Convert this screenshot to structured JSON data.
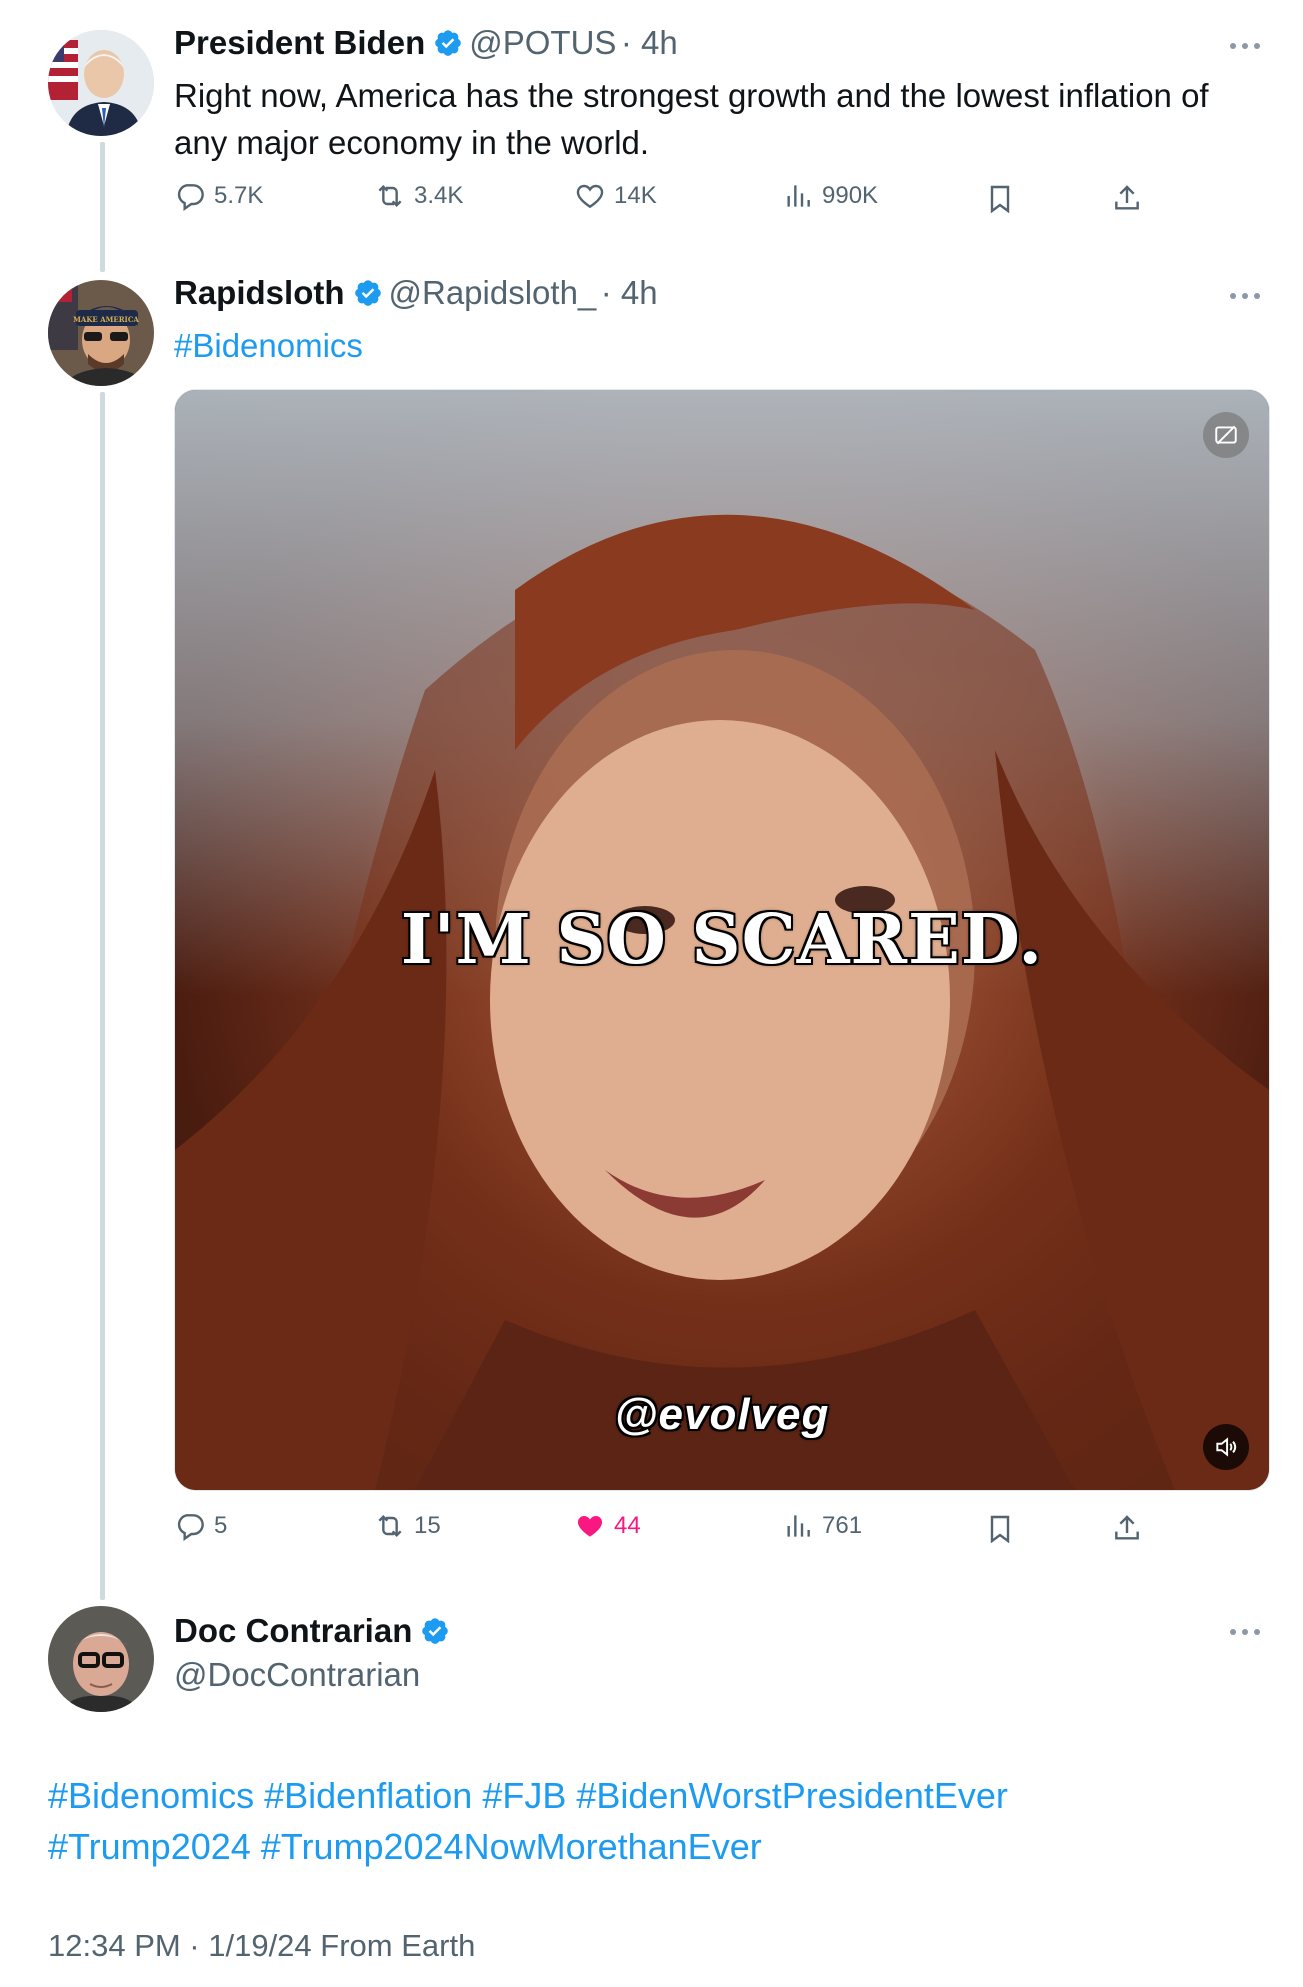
{
  "tweets": [
    {
      "display_name": "President Biden",
      "handle": "@POTUS",
      "time": "· 4h",
      "text_lines": [
        "Right now, America has the strongest growth and the lowest inflation of",
        "any major economy in the world."
      ],
      "stats": {
        "replies": "5.7K",
        "reposts": "3.4K",
        "likes": "14K",
        "views": "990K"
      },
      "liked": false
    },
    {
      "display_name": "Rapidsloth",
      "handle": "@Rapidsloth_",
      "time": "· 4h",
      "hashtag": "#Bidenomics",
      "media": {
        "caption": "I'M SO SCARED.",
        "watermark": "@evolveg"
      },
      "stats": {
        "replies": "5",
        "reposts": "15",
        "likes": "44",
        "views": "761"
      },
      "liked": true
    }
  ],
  "main_tweet": {
    "display_name": "Doc Contrarian",
    "handle": "@DocContrarian",
    "hashtag_lines": [
      [
        "#Bidenomics",
        "#Bidenflation",
        "#FJB",
        "#BidenWorstPresidentEver"
      ],
      [
        "#Trump2024",
        "#Trump2024NowMorethanEver"
      ]
    ],
    "timestamp": "12:34 PM · 1/19/24 From Earth"
  },
  "colors": {
    "link": "#1d9bf0",
    "verified": "#1d9bf0",
    "like_active": "#f91880",
    "muted": "#536471"
  },
  "icons": [
    "verified-badge-icon",
    "more-icon",
    "reply-icon",
    "repost-icon",
    "like-icon",
    "views-icon",
    "bookmark-icon",
    "share-icon",
    "gif-toggle-icon",
    "volume-icon"
  ]
}
